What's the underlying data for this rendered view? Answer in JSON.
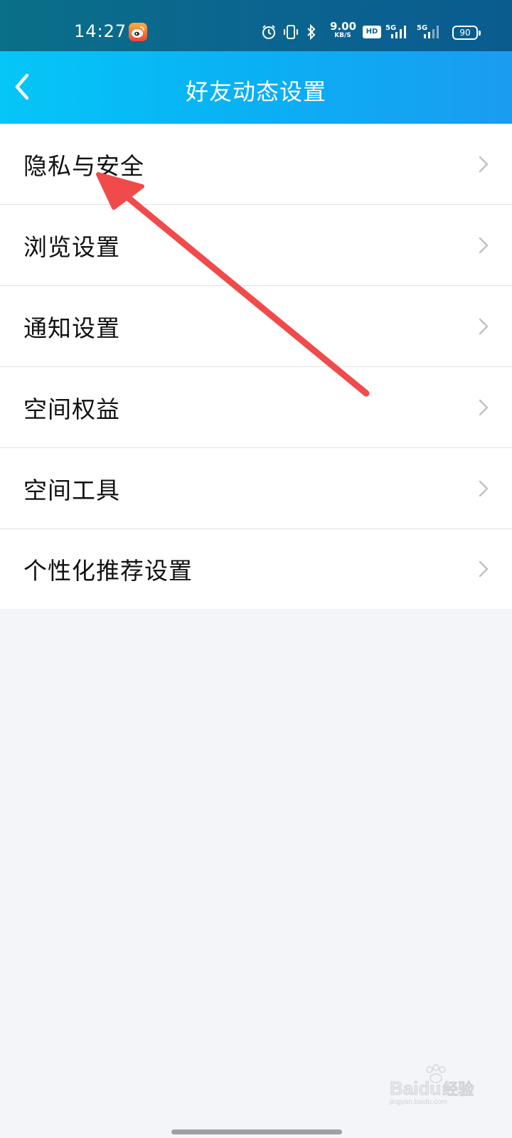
{
  "status_bar": {
    "time": "14:27",
    "speed_value": "9.00",
    "speed_unit": "KB/S",
    "hd_badge": "HD",
    "net1": "5G",
    "net2": "5G",
    "battery": "90",
    "icons": [
      "weibo-app-icon",
      "alarm-icon",
      "vibrate-icon",
      "bluetooth-icon",
      "signal-icon",
      "signal-icon",
      "battery-icon"
    ]
  },
  "header": {
    "title": "好友动态设置",
    "back_icon": "chevron-left-icon"
  },
  "menu": {
    "items": [
      {
        "label": "隐私与安全"
      },
      {
        "label": "浏览设置"
      },
      {
        "label": "通知设置"
      },
      {
        "label": "空间权益"
      },
      {
        "label": "空间工具"
      },
      {
        "label": "个性化推荐设置"
      }
    ],
    "chevron_icon": "chevron-right-icon"
  },
  "watermark": {
    "brand": "Bai",
    "brand_mid": "du",
    "brand_suffix": "经验",
    "url": "jingyan.baidu.com"
  },
  "colors": {
    "status_bar": "#0b6590",
    "header": "#0ab0f4",
    "background": "#f4f5f9",
    "annotation_arrow": "#f04a4a"
  }
}
